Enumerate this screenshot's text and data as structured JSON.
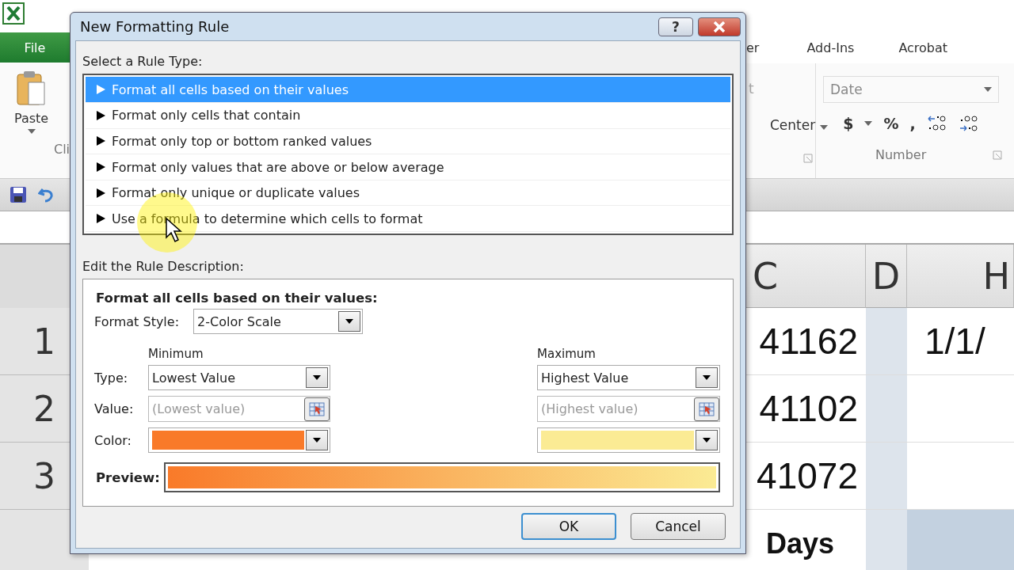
{
  "excel": {
    "file_tab": "File",
    "tabs": [
      "er",
      "Add-Ins",
      "Acrobat"
    ],
    "ribbon": {
      "paste": "Paste",
      "clipboard_group_partial": "Cli",
      "alignment_partial": "t",
      "merge": "Center",
      "number_format": "Date",
      "currency": "$",
      "percent": "%",
      "comma": ",",
      "number_group": "Number"
    },
    "sheet": {
      "columns": [
        "C",
        "D",
        "H"
      ],
      "rows": [
        {
          "header": "1",
          "c": "41162",
          "h": "1/1/"
        },
        {
          "header": "2",
          "c": "41102",
          "h": ""
        },
        {
          "header": "3",
          "c": "41072",
          "h": ""
        }
      ],
      "below_text": "Days"
    }
  },
  "dialog": {
    "title": "New Formatting Rule",
    "help": "?",
    "rule_type_label": "Select a Rule Type:",
    "rule_types": [
      {
        "label": "Format all cells based on their values",
        "selected": true
      },
      {
        "label": "Format only cells that contain",
        "selected": false
      },
      {
        "label": "Format only top or bottom ranked values",
        "selected": false
      },
      {
        "label": "Format only values that are above or below average",
        "selected": false
      },
      {
        "label": "Format only unique or duplicate values",
        "selected": false
      },
      {
        "label": "Use a formula to determine which cells to format",
        "selected": false
      }
    ],
    "description_label": "Edit the Rule Description:",
    "heading": "Format all cells based on their values:",
    "format_style_label": "Format Style:",
    "format_style": "2-Color Scale",
    "row_labels": [
      "Type:",
      "Value:",
      "Color:"
    ],
    "ends": [
      {
        "heading": "Minimum",
        "type": "Lowest Value",
        "value_placeholder": "(Lowest value)",
        "color": "#f97a29"
      },
      {
        "heading": "Maximum",
        "type": "Highest Value",
        "value_placeholder": "(Highest value)",
        "color": "#fbeb94"
      }
    ],
    "preview_label": "Preview:",
    "buttons": [
      {
        "label": "OK",
        "default": true
      },
      {
        "label": "Cancel",
        "default": false
      }
    ]
  }
}
